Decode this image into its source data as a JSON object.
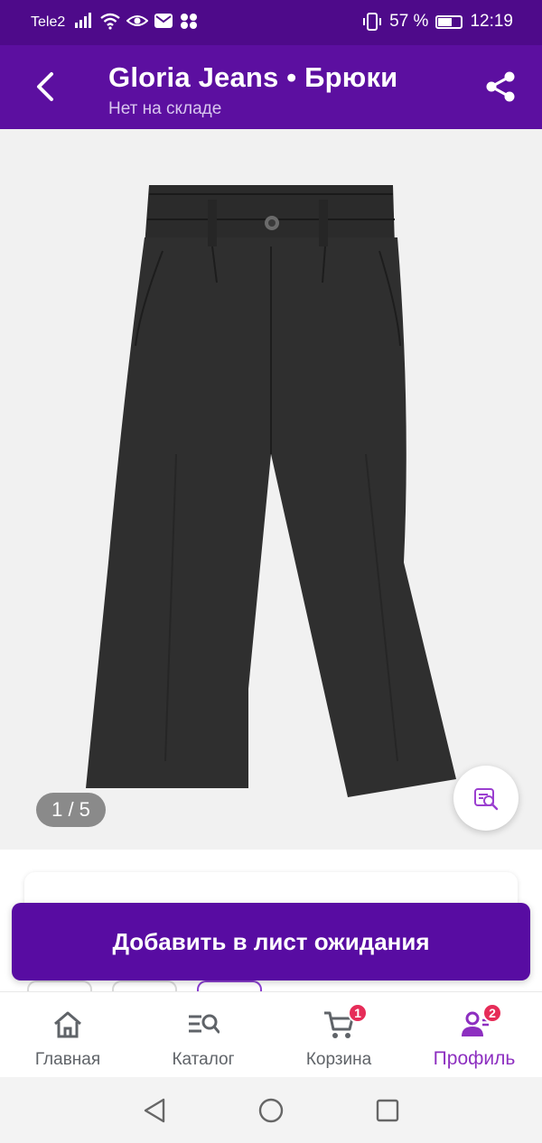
{
  "status_bar": {
    "carrier": "Tele2",
    "battery_text": "57 %",
    "battery_level": 0.57,
    "time": "12:19"
  },
  "header": {
    "title": "Gloria Jeans • Брюки",
    "subtitle": "Нет на складе",
    "back_icon": "chevron-left-icon",
    "share_icon": "share-icon"
  },
  "gallery": {
    "counter": "1 / 5",
    "current": 1,
    "total": 5,
    "lens_icon": "visual-search-icon"
  },
  "cta": {
    "label": "Добавить в лист ожидания"
  },
  "bottom_nav": {
    "items": [
      {
        "label": "Главная",
        "icon": "home-icon"
      },
      {
        "label": "Каталог",
        "icon": "catalog-search-icon"
      },
      {
        "label": "Корзина",
        "icon": "cart-icon",
        "badge": "1"
      },
      {
        "label": "Профиль",
        "icon": "profile-icon",
        "badge": "2",
        "active": true
      }
    ]
  },
  "colors": {
    "status_bar": "#4e0a8a",
    "app_bar": "#5c0fa0",
    "cta": "#580ca2",
    "active_nav": "#8d2fc0",
    "badge": "#e62c58"
  }
}
